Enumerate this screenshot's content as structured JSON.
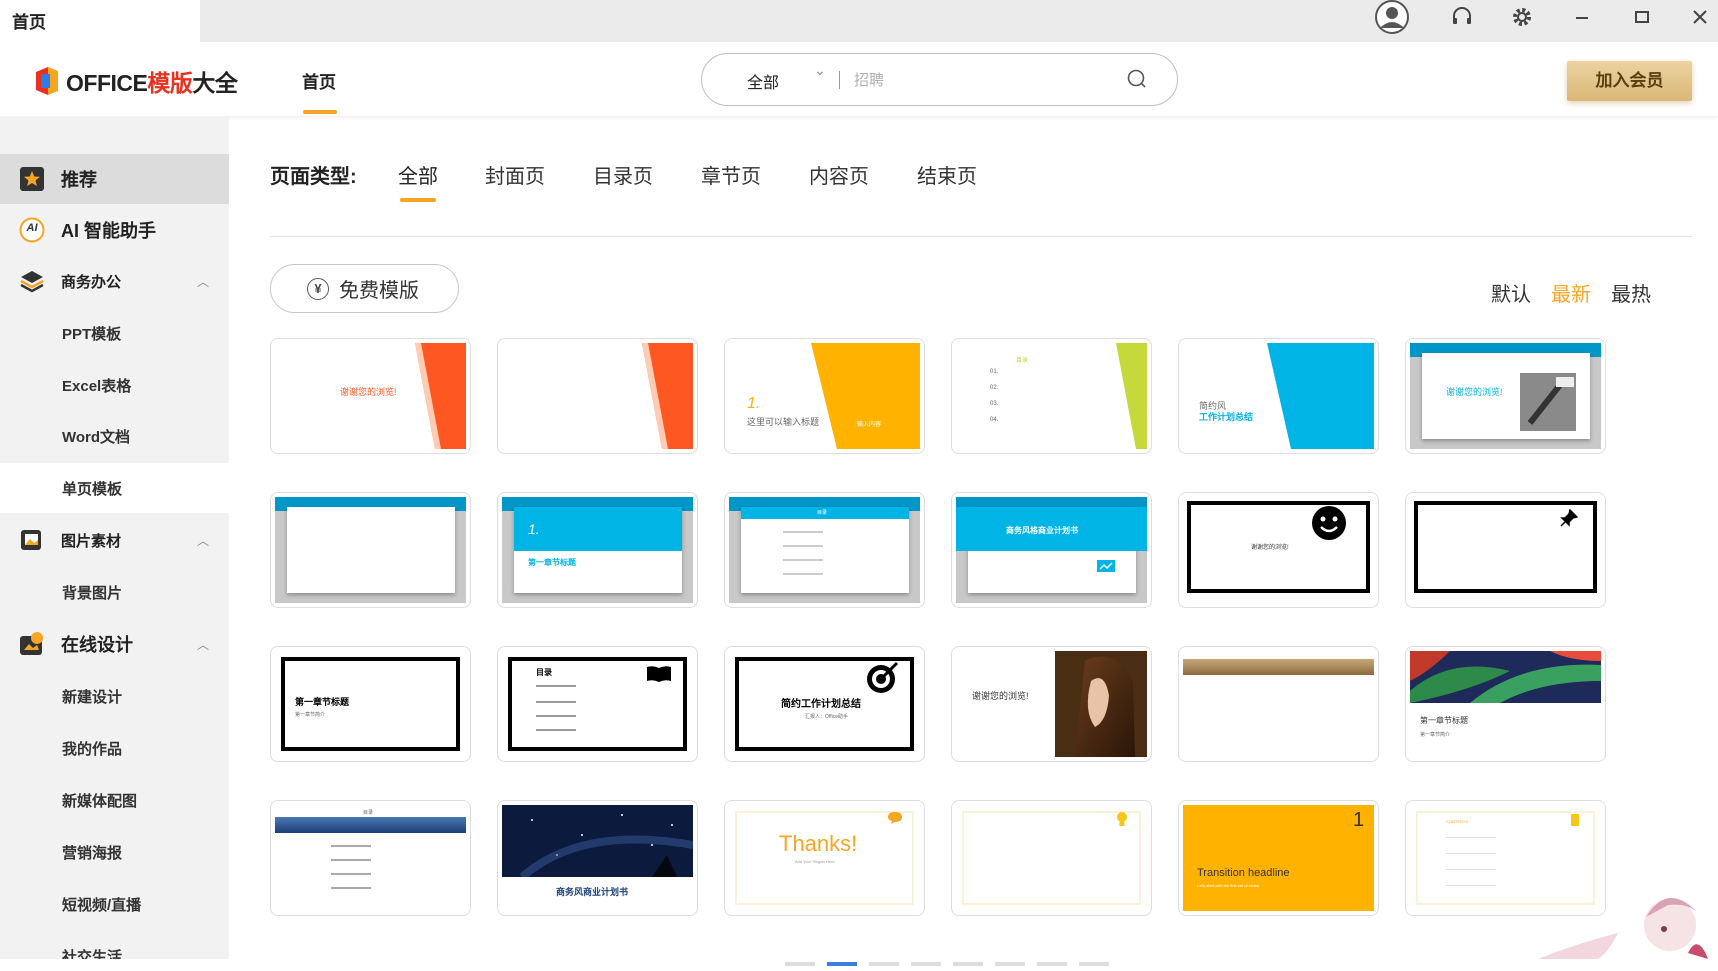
{
  "window": {
    "tab_title": "首页"
  },
  "header": {
    "logo_brand": "OFFICE",
    "logo_red": "模版",
    "logo_tail": "大全",
    "nav_home": "首页",
    "search": {
      "category": "全部",
      "placeholder": "招聘"
    },
    "vip_button": "加入会员"
  },
  "sidebar": {
    "recommend": "推荐",
    "ai_assistant": "AI 智能助手",
    "ai_badge": "AI",
    "business": "商务办公",
    "ppt": "PPT模板",
    "excel": "Excel表格",
    "word": "Word文档",
    "single_page": "单页模板",
    "images": "图片素材",
    "backgrounds": "背景图片",
    "online_design": "在线设计",
    "new_design": "新建设计",
    "my_works": "我的作品",
    "new_media": "新媒体配图",
    "marketing_poster": "营销海报",
    "short_video": "短视频/直播",
    "social_life": "社交生活"
  },
  "filters": {
    "page_type_label": "页面类型:",
    "tabs": [
      "全部",
      "封面页",
      "目录页",
      "章节页",
      "内容页",
      "结束页"
    ],
    "free_templates": "免费模版",
    "free_icon": "¥",
    "sort": [
      "默认",
      "最新",
      "最热"
    ],
    "active_sort": "最新"
  },
  "cards": {
    "c1_text": "谢谢您的浏览!",
    "c3_num": "1.",
    "c3_title": "这里可以输入标题",
    "c3_sub": "输入内容",
    "c4_title": "目录",
    "c4_items": [
      "01.",
      "02.",
      "03.",
      "04."
    ],
    "c5_line1": "简约风",
    "c5_line2": "工作计划总结",
    "c6_text": "谢谢您的浏览!",
    "c8_num": "1.",
    "c8_title": "第一章节标题",
    "c9_title": "目录",
    "c10_title": "商务风格商业计划书",
    "c11_text": "谢谢您的浏览!",
    "c13_title": "第一章节标题",
    "c13_sub": "第一章节简介",
    "c14_title": "目录",
    "c15_title": "简约工作计划总结",
    "c15_sub": "汇报人：Office助手",
    "c16_text": "谢谢您的浏览!",
    "c18_title": "第一章节标题",
    "c18_sub": "第一章节简介",
    "c19_title": "目录",
    "c20_title": "商务风商业计划书",
    "c21_title": "Thanks!",
    "c21_sub": "Add Your Slogan Here",
    "c23_num": "1",
    "c23_title": "Transition headline",
    "c23_sub": "Let's start with the first set of slides",
    "c24_title": "CONTENTS"
  },
  "colors": {
    "accent": "#f5a623",
    "orange": "#ff5722",
    "yellow": "#ffb300",
    "lime": "#c5d93a",
    "cyan": "#00b4e6"
  }
}
